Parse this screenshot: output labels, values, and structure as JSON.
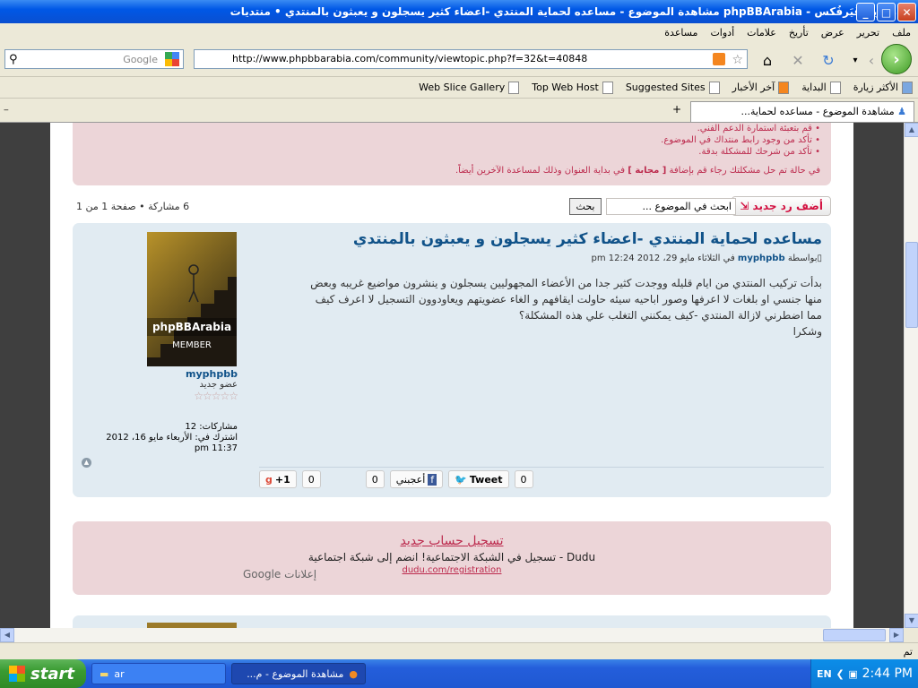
{
  "window": {
    "title": "موزيلا فَيَرفُكس - phpBBArabia مشاهدة الموضوع - مساعده لحماية المنتدي -اعضاء كثير يسجلون و يعبثون بالمنتدي • منتديات"
  },
  "menu": [
    "ملف",
    "تحرير",
    "عرض",
    "تأريخ",
    "علامات",
    "أدوات",
    "مساعدة"
  ],
  "nav": {
    "search_placeholder": "Google",
    "url": "http://www.phpbbarabia.com/community/viewtopic.php?f=32&t=40848"
  },
  "bookmarks": [
    "الأكثر زيارة",
    "البداية",
    "آخر الأخبار",
    "Suggested Sites",
    "Top Web Host",
    "Web Slice Gallery"
  ],
  "tab": {
    "label": "مشاهدة الموضوع - مساعده لحماية..."
  },
  "notice": {
    "items": [
      "قم بتعبئة استمارة الدعم الفني.",
      "تأكد من وجود رابط منتداك في الموضوع.",
      "تأكد من شرحك للمشكلة بدقة."
    ],
    "footer_pre": "في حالة تم حل مشكلتك رجاء قم بإضافة",
    "footer_tag": "[ مجابة ]",
    "footer_post": "في بداية العنوان وذلك لمساعدة الآخرين أيضاً."
  },
  "actions": {
    "new_reply": "أضف رد جديد",
    "search_placeholder": "ابحث في الموضوع ...",
    "search_button": "بحث",
    "pagination": "6 مشاركة • صفحة 1 من 1"
  },
  "post": {
    "title": "مساعده لحماية المنتدي -اعضاء كثير يسجلون و يعبثون بالمنتدي",
    "meta_by": "بواسطة",
    "author": "myphpbb",
    "date": "في الثلاثاء مايو 29، 2012 12:24 pm",
    "body": [
      "بدأت تركيب المنتدي من ايام قليله ووجدت كثير جدا من الأعضاء المجهوليين يسجلون و ينشرون مواضيع غريبه وبعض",
      "منها جنسي او بلغات لا اعرفها وصور اباحيه سيئه حاولت ايقافهم و الغاء عضويتهم ويعاودوون التسجيل لا اعرف كيف",
      "مما اضطرني لازالة المنتدي -كيف يمكنني التغلب علي هذه المشكلة؟",
      "وشكرا"
    ],
    "avatar_brand": "phpBBArabia",
    "avatar_rank": "MEMBER",
    "profile": {
      "username": "myphpbb",
      "rank": "عضو جديد",
      "stars": "☆☆☆☆☆",
      "posts": "مشاركات: 12",
      "joined": "اشترك في: الأربعاء مايو 16، 2012 11:37 pm"
    },
    "social": {
      "gplus_count": "0",
      "gplus_label": "+1",
      "fb_count": "0",
      "fb_label": "أعجبني",
      "tweet_label": "Tweet",
      "tweet_count": "0"
    }
  },
  "ad": {
    "title": "تسجيل حساب جديد",
    "desc": "تسجيل في الشبكة الاجتماعية! انضم إلى شبكة اجتماعية - Dudu",
    "url": "dudu.com/registration",
    "google": "Google إعلانات"
  },
  "status": {
    "text": "تم"
  },
  "taskbar": {
    "start": "start",
    "task1": "ar",
    "task2": "مشاهدة الموضوع - م...",
    "lang": "EN",
    "time": "2:44 PM"
  }
}
